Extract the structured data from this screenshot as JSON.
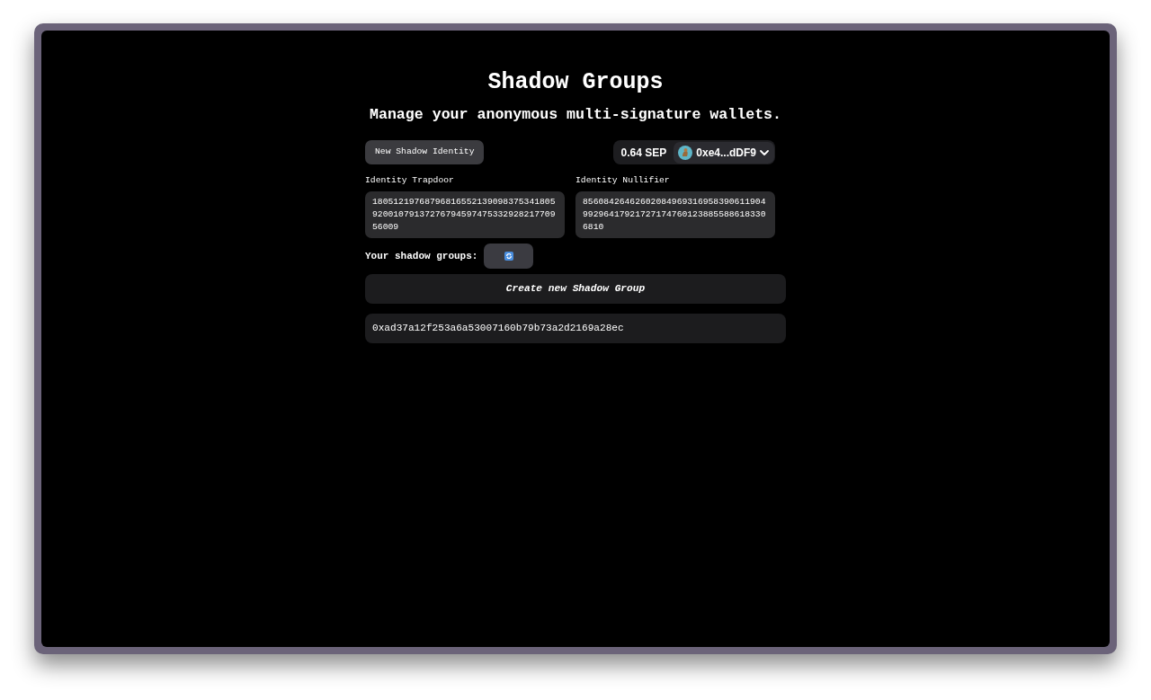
{
  "title": "Shadow Groups",
  "subtitle": "Manage your anonymous multi-signature wallets.",
  "new_identity_button": "New Shadow Identity",
  "wallet": {
    "balance": "0.64 SEP",
    "address": "0xe4...dDF9"
  },
  "identity_fields": [
    {
      "label": "Identity Trapdoor",
      "value": "180512197687968165521390983753418059200107913727679459747533292821770956009"
    },
    {
      "label": "Identity Nullifier",
      "value": "85608426462602084969316958390611904992964179217271747601238855886183306810"
    }
  ],
  "groups": {
    "label": "Your shadow groups:",
    "create_button": "Create new Shadow Group",
    "items": [
      "0xad37a12f253a6a53007160b79b73a2d2169a28ec"
    ]
  }
}
